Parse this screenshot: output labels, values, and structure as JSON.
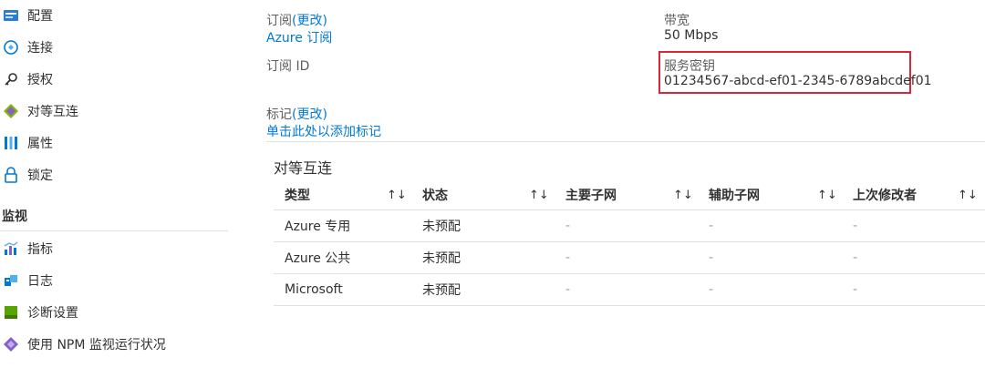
{
  "sidebar": {
    "items": [
      {
        "label": "配置",
        "icon": "configuration-icon"
      },
      {
        "label": "连接",
        "icon": "connection-icon"
      },
      {
        "label": "授权",
        "icon": "key-icon"
      },
      {
        "label": "对等互连",
        "icon": "peering-icon"
      },
      {
        "label": "属性",
        "icon": "properties-icon"
      },
      {
        "label": "锁定",
        "icon": "lock-icon"
      }
    ],
    "monitoring_header": "监视",
    "monitoring_items": [
      {
        "label": "指标",
        "icon": "metrics-icon"
      },
      {
        "label": "日志",
        "icon": "logs-icon"
      },
      {
        "label": "诊断设置",
        "icon": "diagnostic-settings-icon"
      },
      {
        "label": "使用 NPM 监视运行状况",
        "icon": "npm-icon"
      }
    ]
  },
  "essentials": {
    "subscription_label": "订阅",
    "subscription_change": "(更改)",
    "subscription_value": "Azure 订阅",
    "subscription_id_label": "订阅 ID",
    "bandwidth_label": "带宽",
    "bandwidth_value": "50 Mbps",
    "service_key_label": "服务密钥",
    "service_key_value": "01234567-abcd-ef01-2345-6789abcdef01",
    "tags_label": "标记",
    "tags_change": "(更改)",
    "tags_add": "单击此处以添加标记"
  },
  "peering": {
    "title": "对等互连",
    "sort_glyph": "↑↓",
    "columns": [
      "类型",
      "状态",
      "主要子网",
      "辅助子网",
      "上次修改者"
    ],
    "rows": [
      [
        "Azure 专用",
        "未预配",
        "-",
        "-",
        "-"
      ],
      [
        "Azure 公共",
        "未预配",
        "-",
        "-",
        "-"
      ],
      [
        "Microsoft",
        "未预配",
        "-",
        "-",
        "-"
      ]
    ]
  },
  "colors": {
    "link": "#0078d4",
    "highlight": "#d9263b",
    "divider": "#e1dfdd"
  }
}
